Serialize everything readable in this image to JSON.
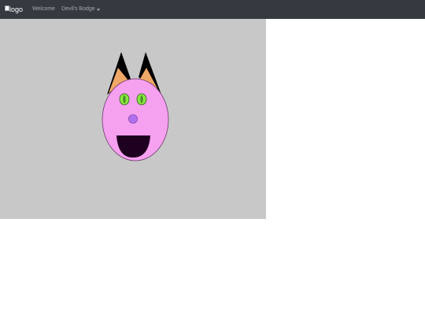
{
  "navbar": {
    "logo_alt": "logo",
    "links": [
      {
        "label": "Welcome"
      },
      {
        "label": "Devil's Bodge"
      }
    ]
  },
  "colors": {
    "navbar_bg": "#343a40",
    "canvas_bg": "#c8c8c8",
    "face_fill": "#f6a0f0",
    "ear_outer": "#000000",
    "ear_inner": "#f0a868",
    "eye_fill": "#88e840",
    "pupil_fill": "#4a8a2a",
    "nose_fill": "#b070f0",
    "mouth_fill": "#1e0020"
  },
  "canvas": {
    "drawing": "devil-face",
    "icons": [
      "left-ear-icon",
      "right-ear-icon",
      "face-icon",
      "left-eye-icon",
      "right-eye-icon",
      "nose-icon",
      "mouth-icon"
    ]
  }
}
